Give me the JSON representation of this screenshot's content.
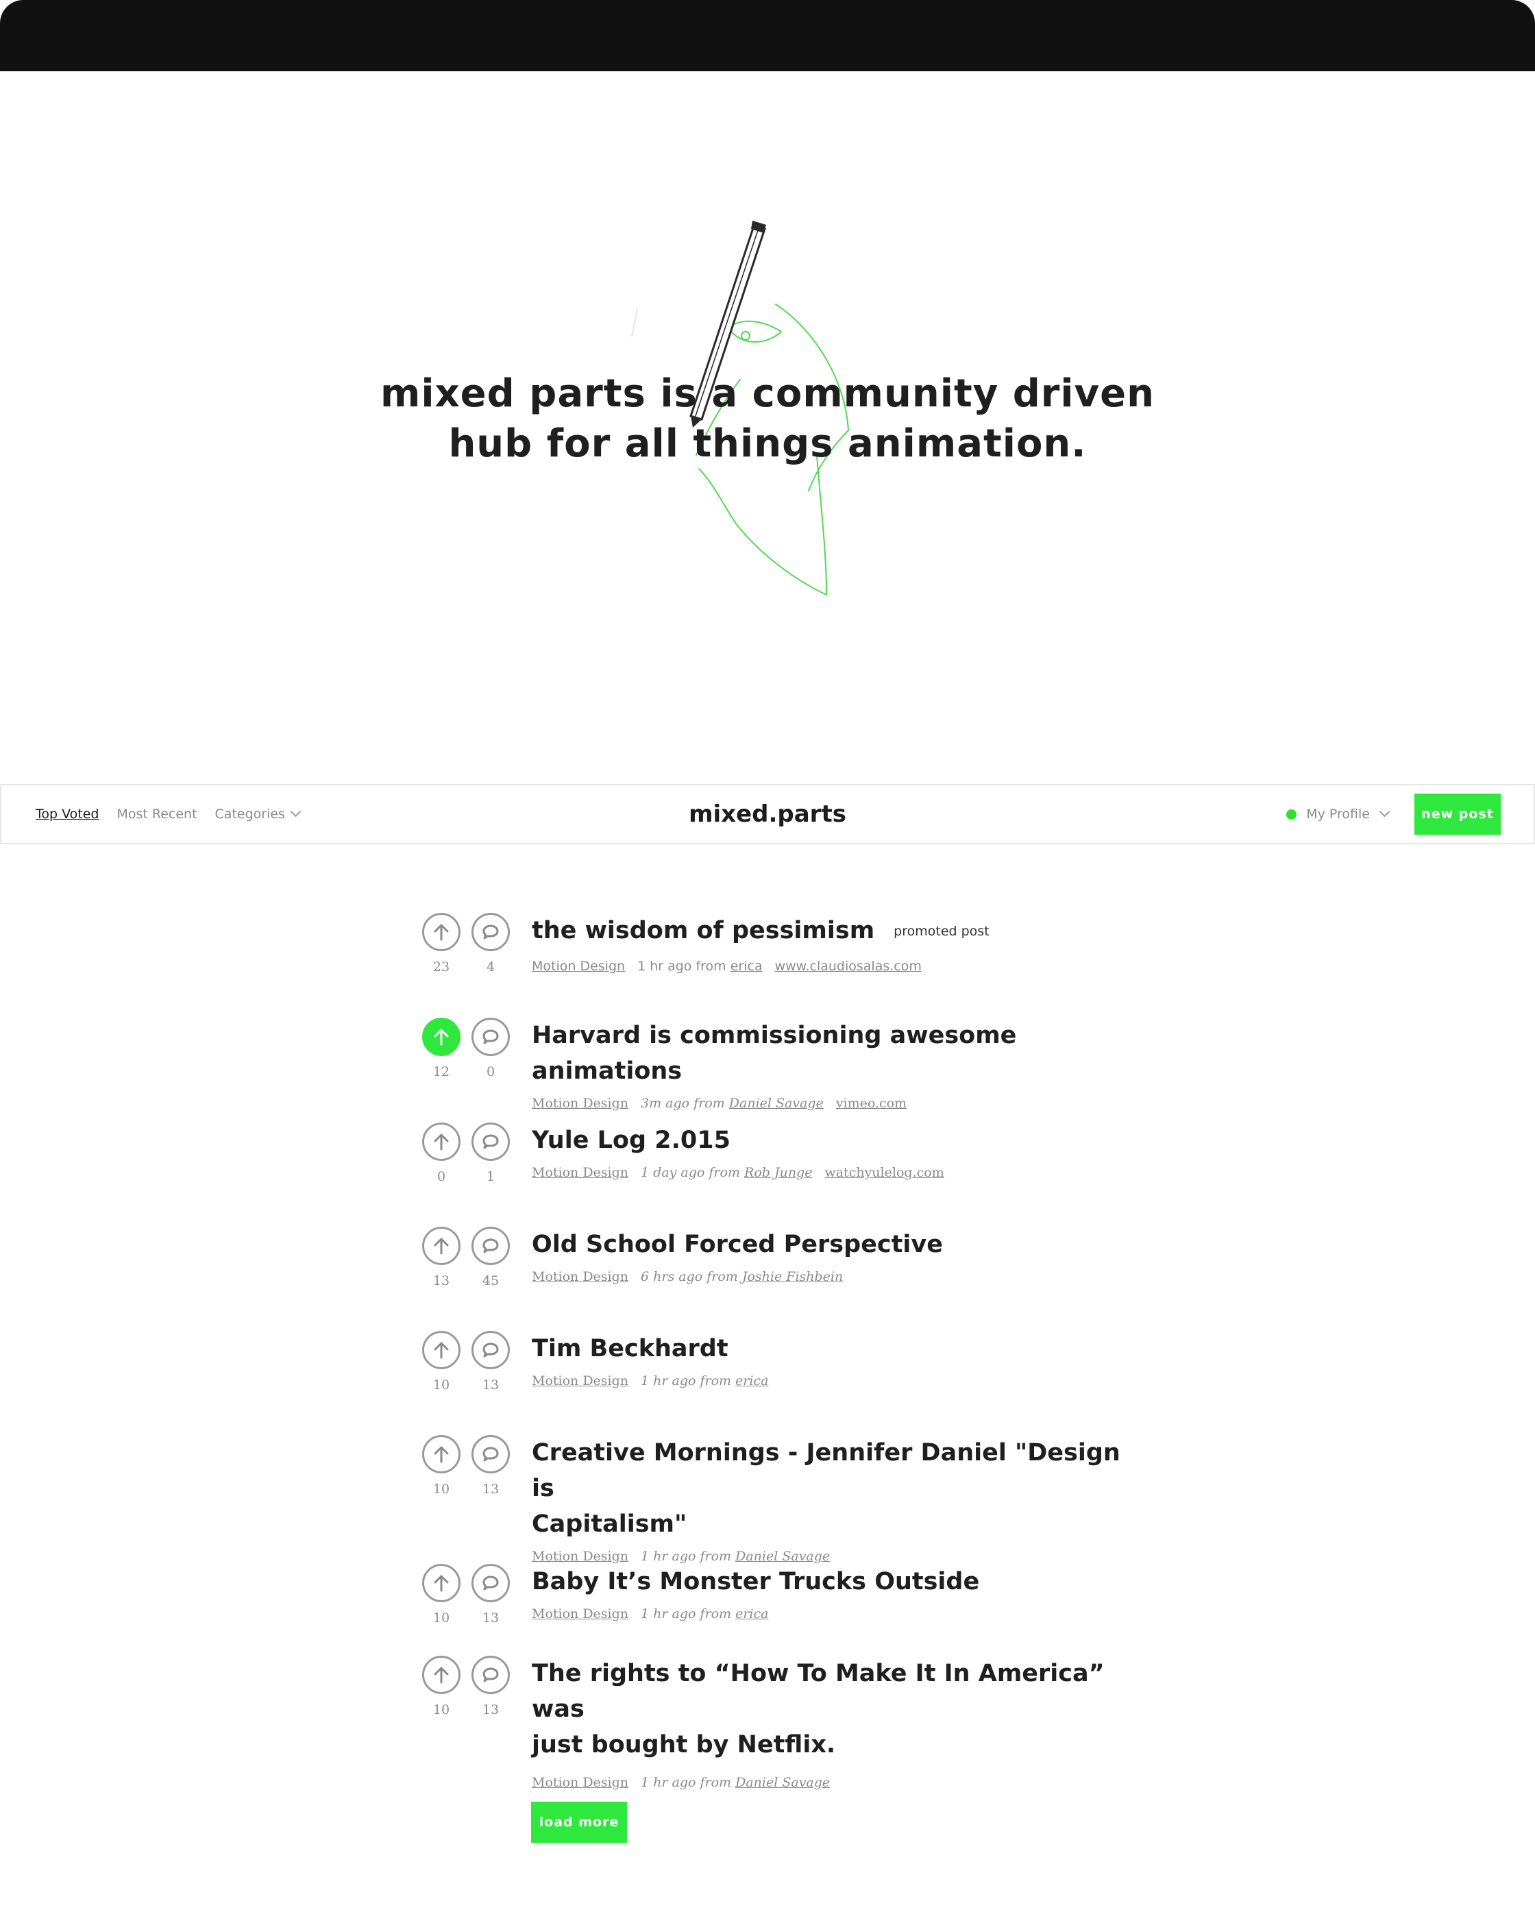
{
  "hero": {
    "line1": "mixed parts is a community driven",
    "line2": "hub for all things animation."
  },
  "nav": {
    "top_voted": "Top Voted",
    "most_recent": "Most Recent",
    "categories": "Categories",
    "brand": "mixed.parts",
    "my_profile": "My Profile",
    "new_post": "new post"
  },
  "colors": {
    "accent_green": "#2fe83e",
    "text": "#1c1c1c",
    "muted": "#8a8a8a",
    "window_bar": "#111111"
  },
  "icons": {
    "upvote": "arrow-up-icon",
    "comment": "speech-bubble-icon",
    "status": "online-dot-icon",
    "dropdown": "chevron-down-icon",
    "hero": "pencil-drawing-illustration"
  },
  "posts": [
    {
      "title": "the wisdom of pessimism",
      "badge": "promoted post",
      "votes": "23",
      "comments": "4",
      "category": "Motion Design",
      "time": "1 hr ago from",
      "author": "erica",
      "domain": "www.claudiosalas.com",
      "upvoted": false
    },
    {
      "title": "Harvard is commissioning awesome animations",
      "votes": "12",
      "comments": "0",
      "category": "Motion Design",
      "time": "3m ago from",
      "author": "Daniel Savage",
      "domain": "vimeo.com",
      "upvoted": true
    },
    {
      "title": "Yule Log 2.015",
      "votes": "0",
      "comments": "1",
      "category": "Motion Design",
      "time": "1 day ago from",
      "author": "Rob Junge",
      "domain": "watchyulelog.com",
      "upvoted": false
    },
    {
      "title": "Old School Forced Perspective",
      "votes": "13",
      "comments": "45",
      "category": "Motion Design",
      "time": "6 hrs ago from",
      "author": "Joshie Fishbein",
      "upvoted": false
    },
    {
      "title": "Tim Beckhardt",
      "votes": "10",
      "comments": "13",
      "category": "Motion Design",
      "time": "1 hr ago from",
      "author": "erica",
      "upvoted": false
    },
    {
      "title_line1": "Creative Mornings - Jennifer Daniel \"Design is",
      "title_line2": "Capitalism\"",
      "votes": "10",
      "comments": "13",
      "category": "Motion Design",
      "time": "1 hr ago from",
      "author": "Daniel Savage",
      "upvoted": false
    },
    {
      "title": "Baby It’s Monster Trucks Outside",
      "votes": "10",
      "comments": "13",
      "category": "Motion Design",
      "time": "1 hr ago from",
      "author": "erica",
      "upvoted": false
    },
    {
      "title_line1": "The rights to “How To Make It In America” was",
      "title_line2": "just bought by Netflix.",
      "votes": "10",
      "comments": "13",
      "category": "Motion Design",
      "time": "1 hr ago from",
      "author": "Daniel Savage",
      "upvoted": false
    }
  ],
  "load_more": "load more"
}
